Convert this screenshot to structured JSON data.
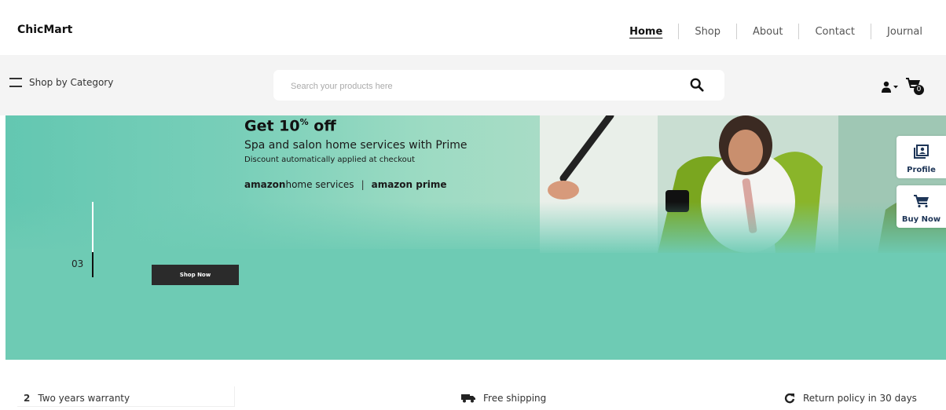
{
  "brand": {
    "name": "ChicMart"
  },
  "nav": {
    "home": "Home",
    "shop": "Shop",
    "about": "About",
    "contact": "Contact",
    "journal": "Journal"
  },
  "category": {
    "label": "Shop by Category"
  },
  "search": {
    "placeholder": "Search your products here",
    "value": ""
  },
  "cart": {
    "count": "0"
  },
  "hero": {
    "title_main": "Get 10",
    "title_sup": "%",
    "title_end": " off",
    "subtitle": "Spa and salon home services with Prime",
    "note": "Discount automatically applied at checkout",
    "brand1": "amazon",
    "brand1_rest": " home services",
    "separator": "|",
    "brand2": "amazon prime",
    "slide_number": "03",
    "cta": "Shop Now"
  },
  "side": {
    "profile": "Profile",
    "buy_now": "Buy Now"
  },
  "features": {
    "warranty_num": "2",
    "warranty": "Two years warranty",
    "shipping": "Free shipping",
    "returns": "Return policy in 30 days"
  },
  "colors": {
    "hero_bg": "#6ecbb4",
    "cta_bg": "#2b2b2b",
    "side_text": "#1d3557"
  }
}
